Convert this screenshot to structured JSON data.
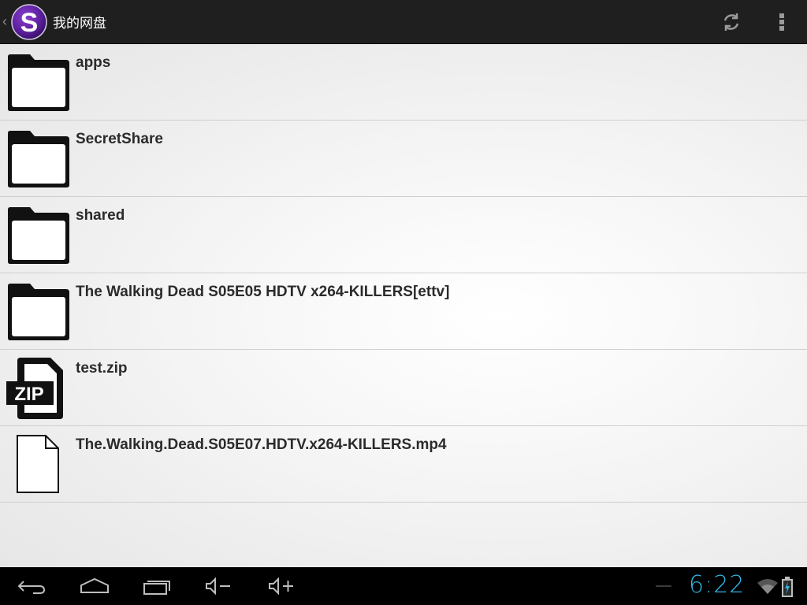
{
  "action_bar": {
    "title": "我的网盘",
    "up_caret": "‹",
    "logo_letter": "S",
    "icons": [
      "refresh-icon",
      "overflow-menu-icon"
    ]
  },
  "files": [
    {
      "name": "apps",
      "type": "folder"
    },
    {
      "name": "SecretShare",
      "type": "folder"
    },
    {
      "name": "shared",
      "type": "folder"
    },
    {
      "name": "The Walking Dead S05E05 HDTV x264-KILLERS[ettv]",
      "type": "folder"
    },
    {
      "name": "test.zip",
      "type": "zip",
      "badge": "ZIP"
    },
    {
      "name": "The.Walking.Dead.S05E07.HDTV.x264-KILLERS.mp4",
      "type": "file"
    }
  ],
  "system_bar": {
    "clock": "6:22",
    "nav_icons": [
      "back-icon",
      "home-icon",
      "recent-apps-icon",
      "volume-down-icon",
      "volume-up-icon"
    ],
    "status_icons": [
      "wifi-icon",
      "battery-charging-icon"
    ],
    "accent_color": "#33b5e5"
  }
}
